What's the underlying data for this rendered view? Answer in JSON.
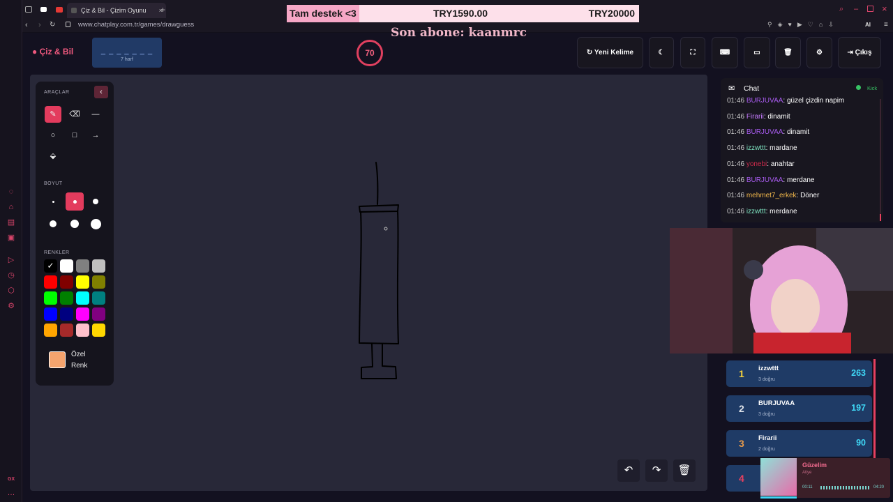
{
  "browser": {
    "tab_title": "Çiz & Bil - Çizim Oyunu",
    "url": "www.chatplay.com.tr/games/drawguess"
  },
  "stream_overlay": {
    "donation_title": "Tam destek <3",
    "donation_current": "TRY1590.00",
    "donation_goal": "TRY20000",
    "last_subscriber": "Son abone: kaanmrc"
  },
  "header": {
    "logo": "Çiz & Bil",
    "word_mask": "_ _ _ _ _ _ _",
    "word_hint": "7 harf",
    "timer": "70",
    "new_word_label": "Yeni Kelime",
    "exit_label": "Çıkış"
  },
  "tools": {
    "title": "ARAÇLAR",
    "size_title": "BOYUT",
    "colors_title": "RENKLER",
    "custom_color_label": "Özel Renk",
    "custom_color": "#f5a46e",
    "palette": [
      "#000000",
      "#ffffff",
      "#808080",
      "#c0c0c0",
      "#ff0000",
      "#800000",
      "#ffff00",
      "#808000",
      "#00ff00",
      "#008000",
      "#00ffff",
      "#008080",
      "#0000ff",
      "#000080",
      "#ff00ff",
      "#800080",
      "#ffa500",
      "#a52a2a",
      "#ffc0cb",
      "#ffd700"
    ],
    "selected_tool": "brush",
    "selected_size": 2
  },
  "chat": {
    "title": "Chat",
    "platform": "Kick",
    "messages": [
      {
        "time": "01:46",
        "user": "BURJUVAA",
        "color": "#a95cf0",
        "text": ": güzel çizdin napim"
      },
      {
        "time": "01:46",
        "user": "Firarii",
        "color": "#c67cff",
        "text": ": dinamit"
      },
      {
        "time": "01:46",
        "user": "BURJUVAA",
        "color": "#a95cf0",
        "text": ": dinamit"
      },
      {
        "time": "01:46",
        "user": "izzwttt",
        "color": "#7ee3c0",
        "text": ": mardane"
      },
      {
        "time": "01:46",
        "user": "yonebi",
        "color": "#c92a4a",
        "text": ": anahtar"
      },
      {
        "time": "01:46",
        "user": "BURJUVAA",
        "color": "#a95cf0",
        "text": ": merdane"
      },
      {
        "time": "01:46",
        "user": "mehmet7_erkek",
        "color": "#f2b84b",
        "text": ": Döner"
      },
      {
        "time": "01:46",
        "user": "izzwttt",
        "color": "#7ee3c0",
        "text": ": merdane"
      }
    ]
  },
  "leaderboard": [
    {
      "rank": "1",
      "name": "izzwttt",
      "correct": "3 doğru",
      "score": "263",
      "rank_color": "#f5d23c"
    },
    {
      "rank": "2",
      "name": "BURJUVAA",
      "correct": "3 doğru",
      "score": "197",
      "rank_color": "#dfe3ea"
    },
    {
      "rank": "3",
      "name": "Firarii",
      "correct": "2 doğru",
      "score": "90",
      "rank_color": "#e79a4a"
    },
    {
      "rank": "4",
      "name": "",
      "correct": "",
      "score": "",
      "rank_color": "#e6405f"
    }
  ],
  "music": {
    "title": "Güzelim",
    "artist": "Atiye",
    "elapsed": "00:11",
    "total": "04:20"
  }
}
